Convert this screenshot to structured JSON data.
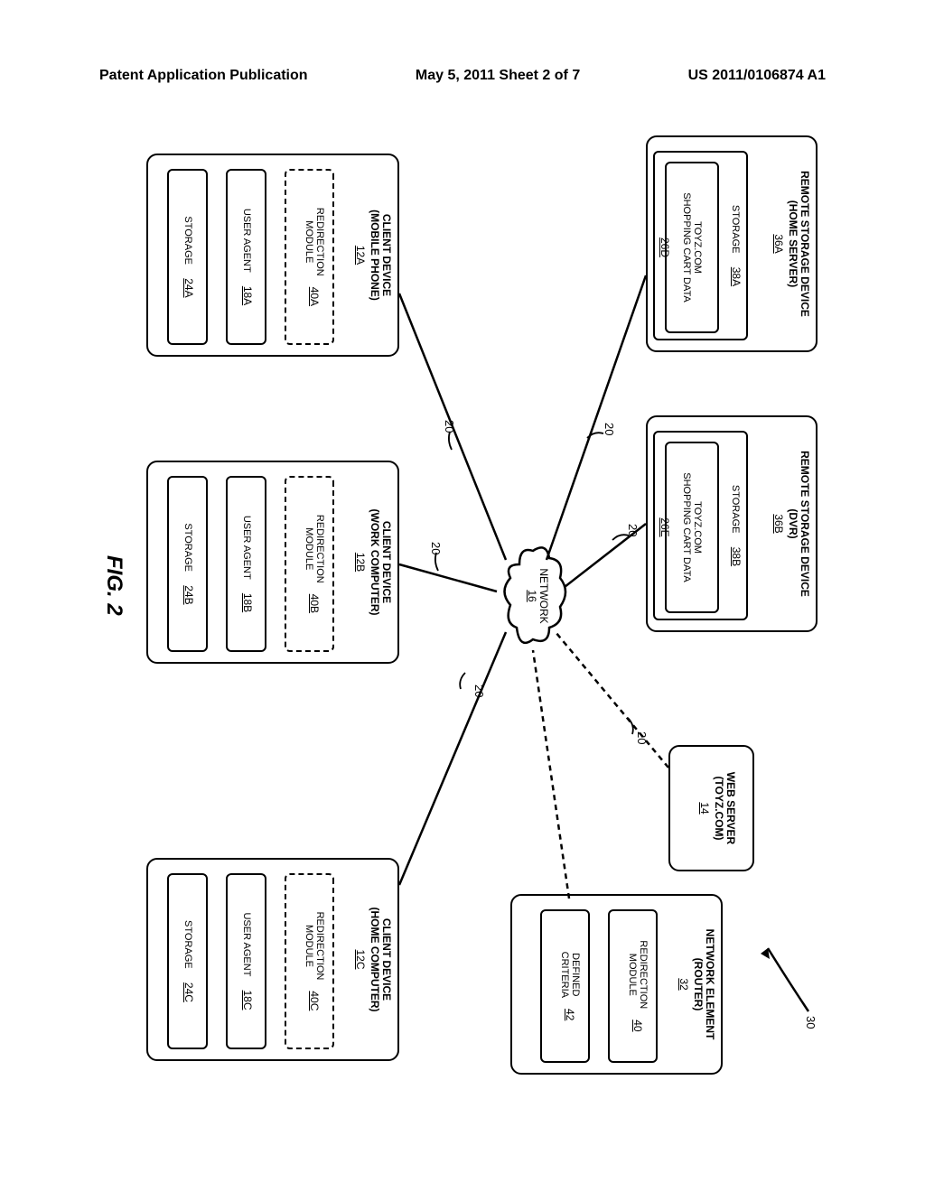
{
  "header": {
    "left": "Patent Application Publication",
    "center": "May 5, 2011  Sheet 2 of 7",
    "right": "US 2011/0106874 A1"
  },
  "figure_label": "FIG. 2",
  "system_ref": "30",
  "boxes": {
    "remote_a": {
      "title": "REMOTE STORAGE DEVICE\n(HOME SERVER)",
      "ref": "36A",
      "storage": {
        "label": "STORAGE",
        "ref": "38A"
      },
      "data": {
        "label": "TOYZ.COM\nSHOPPING CART DATA",
        "ref": "26D"
      }
    },
    "remote_b": {
      "title": "REMOTE STORAGE DEVICE\n(DVR)",
      "ref": "36B",
      "storage": {
        "label": "STORAGE",
        "ref": "38B"
      },
      "data": {
        "label": "TOYZ.COM\nSHOPPING CART DATA",
        "ref": "26E"
      }
    },
    "webserver": {
      "title": "WEB SERVER\n(TOYZ.COM)",
      "ref": "14"
    },
    "network_element": {
      "title": "NETWORK ELEMENT\n(ROUTER)",
      "ref": "32",
      "redir": {
        "label": "REDIRECTION\nMODULE",
        "ref": "40"
      },
      "criteria": {
        "label": "DEFINED\nCRITERIA",
        "ref": "42"
      }
    },
    "network": {
      "label": "NETWORK",
      "ref": "16"
    },
    "client_a": {
      "title": "CLIENT DEVICE\n(MOBILE PHONE)",
      "ref": "12A",
      "redir": {
        "label": "REDIRECTION\nMODULE",
        "ref": "40A"
      },
      "ua": {
        "label": "USER AGENT",
        "ref": "18A"
      },
      "storage": {
        "label": "STORAGE",
        "ref": "24A"
      }
    },
    "client_b": {
      "title": "CLIENT DEVICE\n(WORK COMPUTER)",
      "ref": "12B",
      "redir": {
        "label": "REDIRECTION\nMODULE",
        "ref": "40B"
      },
      "ua": {
        "label": "USER AGENT",
        "ref": "18B"
      },
      "storage": {
        "label": "STORAGE",
        "ref": "24B"
      }
    },
    "client_c": {
      "title": "CLIENT DEVICE\n(HOME COMPUTER)",
      "ref": "12C",
      "redir": {
        "label": "REDIRECTION\nMODULE",
        "ref": "40C"
      },
      "ua": {
        "label": "USER AGENT",
        "ref": "18C"
      },
      "storage": {
        "label": "STORAGE",
        "ref": "24C"
      }
    }
  },
  "leaders": {
    "n20": "20"
  }
}
